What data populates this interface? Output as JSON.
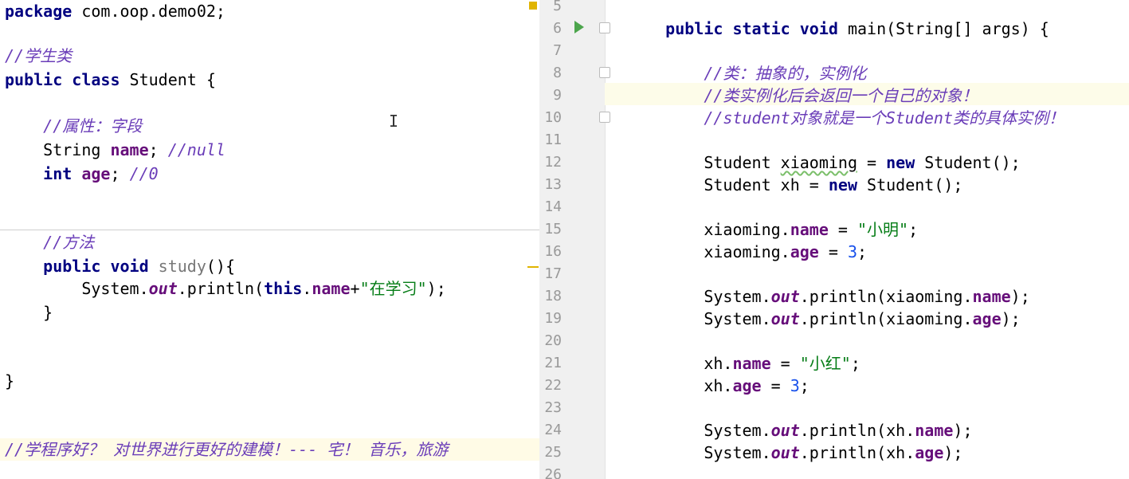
{
  "left_editor": {
    "lines": [
      {
        "id": "l1",
        "segments": [
          {
            "t": "package",
            "c": "kw"
          },
          {
            "t": " com.oop.demo02;",
            "c": ""
          }
        ]
      },
      {
        "id": "l2",
        "segments": [
          {
            "t": "//学生类",
            "c": "cmt"
          }
        ]
      },
      {
        "id": "l3",
        "segments": [
          {
            "t": "public class",
            "c": "kw"
          },
          {
            "t": " Student {",
            "c": ""
          }
        ]
      },
      {
        "id": "l4",
        "segments": [
          {
            "t": "    //属性：字段",
            "c": "cmt"
          }
        ]
      },
      {
        "id": "l5",
        "segments": [
          {
            "t": "    String ",
            "c": ""
          },
          {
            "t": "name",
            "c": "fld"
          },
          {
            "t": "; ",
            "c": ""
          },
          {
            "t": "//null",
            "c": "cmt"
          }
        ]
      },
      {
        "id": "l6",
        "segments": [
          {
            "t": "    ",
            "c": ""
          },
          {
            "t": "int",
            "c": "kw"
          },
          {
            "t": " ",
            "c": ""
          },
          {
            "t": "age",
            "c": "fld"
          },
          {
            "t": "; ",
            "c": ""
          },
          {
            "t": "//0",
            "c": "cmt"
          }
        ]
      },
      {
        "id": "l7",
        "segments": [
          {
            "t": "    //方法",
            "c": "cmt"
          }
        ]
      },
      {
        "id": "l8",
        "segments": [
          {
            "t": "    ",
            "c": ""
          },
          {
            "t": "public void",
            "c": "kw"
          },
          {
            "t": " ",
            "c": ""
          },
          {
            "t": "study",
            "c": "method-gray"
          },
          {
            "t": "(){",
            "c": ""
          }
        ]
      },
      {
        "id": "l9",
        "segments": [
          {
            "t": "        System.",
            "c": ""
          },
          {
            "t": "out",
            "c": "static"
          },
          {
            "t": ".println(",
            "c": ""
          },
          {
            "t": "this",
            "c": "kw"
          },
          {
            "t": ".",
            "c": ""
          },
          {
            "t": "name",
            "c": "fld"
          },
          {
            "t": "+",
            "c": ""
          },
          {
            "t": "\"在学习\"",
            "c": "str"
          },
          {
            "t": ");",
            "c": ""
          }
        ]
      },
      {
        "id": "l10",
        "segments": [
          {
            "t": "    }",
            "c": ""
          }
        ]
      },
      {
        "id": "l11",
        "segments": [
          {
            "t": "}",
            "c": ""
          }
        ]
      },
      {
        "id": "l12",
        "segments": [
          {
            "t": "//学程序好？ 对世界进行更好的建模！--- 宅！ 音乐，旅游",
            "c": "cmt"
          }
        ]
      }
    ]
  },
  "right_editor": {
    "line_numbers": [
      "5",
      "6",
      "7",
      "8",
      "9",
      "10",
      "11",
      "12",
      "13",
      "14",
      "15",
      "16",
      "17",
      "18",
      "19",
      "20",
      "21",
      "22",
      "23",
      "24",
      "25",
      "26"
    ],
    "lines": [
      {
        "n": "5",
        "segments": []
      },
      {
        "n": "6",
        "segments": [
          {
            "t": "    ",
            "c": ""
          },
          {
            "t": "public static void",
            "c": "kw"
          },
          {
            "t": " main(String[] args) {",
            "c": ""
          }
        ]
      },
      {
        "n": "7",
        "segments": []
      },
      {
        "n": "8",
        "segments": [
          {
            "t": "        //类：抽象的，实例化",
            "c": "cmt"
          }
        ]
      },
      {
        "n": "9",
        "segments": [
          {
            "t": "        //类实例化后会返回一个自己的对象！",
            "c": "cmt"
          }
        ]
      },
      {
        "n": "10",
        "segments": [
          {
            "t": "        //student对象就是一个Student类的具体实例！",
            "c": "cmt"
          }
        ]
      },
      {
        "n": "11",
        "segments": []
      },
      {
        "n": "12",
        "segments": [
          {
            "t": "        Student ",
            "c": ""
          },
          {
            "t": "xiaoming",
            "c": "squiggle"
          },
          {
            "t": " = ",
            "c": ""
          },
          {
            "t": "new",
            "c": "kw"
          },
          {
            "t": " Student();",
            "c": ""
          }
        ]
      },
      {
        "n": "13",
        "segments": [
          {
            "t": "        Student xh = ",
            "c": ""
          },
          {
            "t": "new",
            "c": "kw"
          },
          {
            "t": " Student();",
            "c": ""
          }
        ]
      },
      {
        "n": "14",
        "segments": []
      },
      {
        "n": "15",
        "segments": [
          {
            "t": "        xiaoming.",
            "c": ""
          },
          {
            "t": "name",
            "c": "fld"
          },
          {
            "t": " = ",
            "c": ""
          },
          {
            "t": "\"小明\"",
            "c": "str"
          },
          {
            "t": ";",
            "c": ""
          }
        ]
      },
      {
        "n": "16",
        "segments": [
          {
            "t": "        xiaoming.",
            "c": ""
          },
          {
            "t": "age",
            "c": "fld"
          },
          {
            "t": " = ",
            "c": ""
          },
          {
            "t": "3",
            "c": "num"
          },
          {
            "t": ";",
            "c": ""
          }
        ]
      },
      {
        "n": "17",
        "segments": []
      },
      {
        "n": "18",
        "segments": [
          {
            "t": "        System.",
            "c": ""
          },
          {
            "t": "out",
            "c": "static"
          },
          {
            "t": ".println(xiaoming.",
            "c": ""
          },
          {
            "t": "name",
            "c": "fld"
          },
          {
            "t": ");",
            "c": ""
          }
        ]
      },
      {
        "n": "19",
        "segments": [
          {
            "t": "        System.",
            "c": ""
          },
          {
            "t": "out",
            "c": "static"
          },
          {
            "t": ".println(xiaoming.",
            "c": ""
          },
          {
            "t": "age",
            "c": "fld"
          },
          {
            "t": ");",
            "c": ""
          }
        ]
      },
      {
        "n": "20",
        "segments": []
      },
      {
        "n": "21",
        "segments": [
          {
            "t": "        xh.",
            "c": ""
          },
          {
            "t": "name",
            "c": "fld"
          },
          {
            "t": " = ",
            "c": ""
          },
          {
            "t": "\"小红\"",
            "c": "str"
          },
          {
            "t": ";",
            "c": ""
          }
        ]
      },
      {
        "n": "22",
        "segments": [
          {
            "t": "        xh.",
            "c": ""
          },
          {
            "t": "age",
            "c": "fld"
          },
          {
            "t": " = ",
            "c": ""
          },
          {
            "t": "3",
            "c": "num"
          },
          {
            "t": ";",
            "c": ""
          }
        ]
      },
      {
        "n": "23",
        "segments": []
      },
      {
        "n": "24",
        "segments": [
          {
            "t": "        System.",
            "c": ""
          },
          {
            "t": "out",
            "c": "static"
          },
          {
            "t": ".println(xh.",
            "c": ""
          },
          {
            "t": "name",
            "c": "fld"
          },
          {
            "t": ");",
            "c": ""
          }
        ]
      },
      {
        "n": "25",
        "segments": [
          {
            "t": "        System.",
            "c": ""
          },
          {
            "t": "out",
            "c": "static"
          },
          {
            "t": ".println(xh.",
            "c": ""
          },
          {
            "t": "age",
            "c": "fld"
          },
          {
            "t": ");",
            "c": ""
          }
        ]
      },
      {
        "n": "26",
        "segments": []
      }
    ]
  },
  "colors": {
    "keyword": "#000080",
    "comment": "#6a3db8",
    "field": "#660e7a",
    "string": "#067d17",
    "number": "#1750eb",
    "current_line": "#fdfce9"
  }
}
